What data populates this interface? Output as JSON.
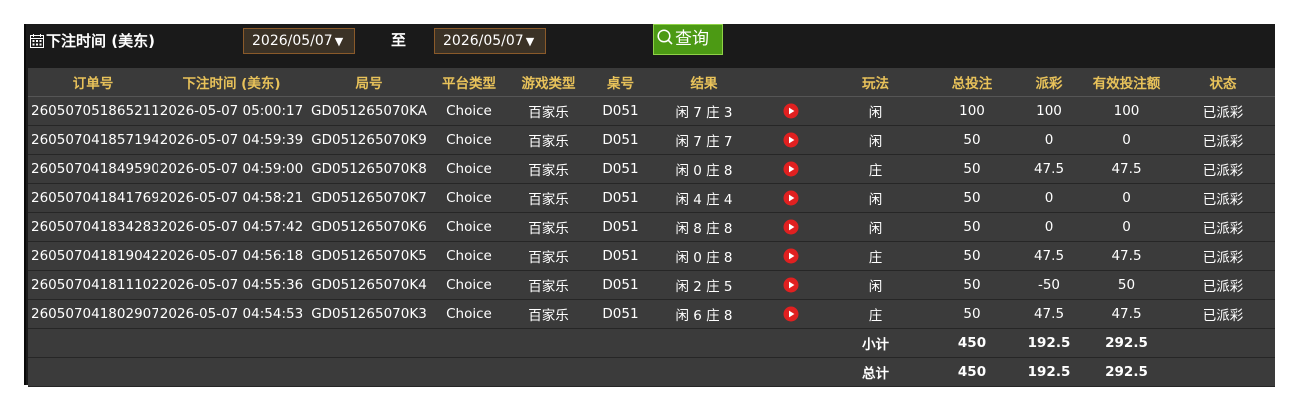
{
  "toolbar": {
    "label": "下注时间 (美东)",
    "start_date": "2026/05/07",
    "to_label": "至",
    "end_date": "2026/05/07",
    "dropdown_arrow": "▼",
    "query_label": "查询"
  },
  "table": {
    "columns": [
      "订单号",
      "下注时间 (美东)",
      "局号",
      "平台类型",
      "游戏类型",
      "桌号",
      "结果",
      "",
      "玩法",
      "总投注",
      "派彩",
      "有效投注额",
      "状态"
    ],
    "rows": [
      {
        "order": "260507051865211",
        "time": "2026-05-07 05:00:17",
        "round": "GD051265070KA",
        "platform": "Choice",
        "game": "百家乐",
        "table": "D051",
        "result": "闲 7 庄 3",
        "play": "闲",
        "bet": "100",
        "payout": "100",
        "valid": "100",
        "status": "已派彩",
        "payout_color": "red"
      },
      {
        "order": "260507041857194",
        "time": "2026-05-07 04:59:39",
        "round": "GD051265070K9",
        "platform": "Choice",
        "game": "百家乐",
        "table": "D051",
        "result": "闲 7 庄 7",
        "play": "闲",
        "bet": "50",
        "payout": "0",
        "valid": "0",
        "status": "已派彩",
        "payout_color": "white"
      },
      {
        "order": "260507041849590",
        "time": "2026-05-07 04:59:00",
        "round": "GD051265070K8",
        "platform": "Choice",
        "game": "百家乐",
        "table": "D051",
        "result": "闲 0 庄 8",
        "play": "庄",
        "bet": "50",
        "payout": "47.5",
        "valid": "47.5",
        "status": "已派彩",
        "payout_color": "red"
      },
      {
        "order": "260507041841769",
        "time": "2026-05-07 04:58:21",
        "round": "GD051265070K7",
        "platform": "Choice",
        "game": "百家乐",
        "table": "D051",
        "result": "闲 4 庄 4",
        "play": "闲",
        "bet": "50",
        "payout": "0",
        "valid": "0",
        "status": "已派彩",
        "payout_color": "white"
      },
      {
        "order": "260507041834283",
        "time": "2026-05-07 04:57:42",
        "round": "GD051265070K6",
        "platform": "Choice",
        "game": "百家乐",
        "table": "D051",
        "result": "闲 8 庄 8",
        "play": "闲",
        "bet": "50",
        "payout": "0",
        "valid": "0",
        "status": "已派彩",
        "payout_color": "white"
      },
      {
        "order": "260507041819042",
        "time": "2026-05-07 04:56:18",
        "round": "GD051265070K5",
        "platform": "Choice",
        "game": "百家乐",
        "table": "D051",
        "result": "闲 0 庄 8",
        "play": "庄",
        "bet": "50",
        "payout": "47.5",
        "valid": "47.5",
        "status": "已派彩",
        "payout_color": "red"
      },
      {
        "order": "260507041811102",
        "time": "2026-05-07 04:55:36",
        "round": "GD051265070K4",
        "platform": "Choice",
        "game": "百家乐",
        "table": "D051",
        "result": "闲 2 庄 5",
        "play": "闲",
        "bet": "50",
        "payout": "-50",
        "valid": "50",
        "status": "已派彩",
        "payout_color": "green"
      },
      {
        "order": "260507041802907",
        "time": "2026-05-07 04:54:53",
        "round": "GD051265070K3",
        "platform": "Choice",
        "game": "百家乐",
        "table": "D051",
        "result": "闲 6 庄 8",
        "play": "庄",
        "bet": "50",
        "payout": "47.5",
        "valid": "47.5",
        "status": "已派彩",
        "payout_color": "red"
      }
    ],
    "subtotal": {
      "label": "小计",
      "bet": "450",
      "payout": "192.5",
      "valid": "292.5"
    },
    "total": {
      "label": "总计",
      "bet": "450",
      "payout": "192.5",
      "valid": "292.5"
    }
  },
  "colors": {
    "header_text": "#e8c25a",
    "status_settled": "#41d400",
    "payout_red": "#c21c2c",
    "payout_green": "#7bd42a",
    "summary": "#e4d200",
    "replay_icon": "#e02020"
  },
  "icons": {
    "toolbar": "calendar-icon",
    "query": "search-icon",
    "row_action": "play-video-icon"
  }
}
